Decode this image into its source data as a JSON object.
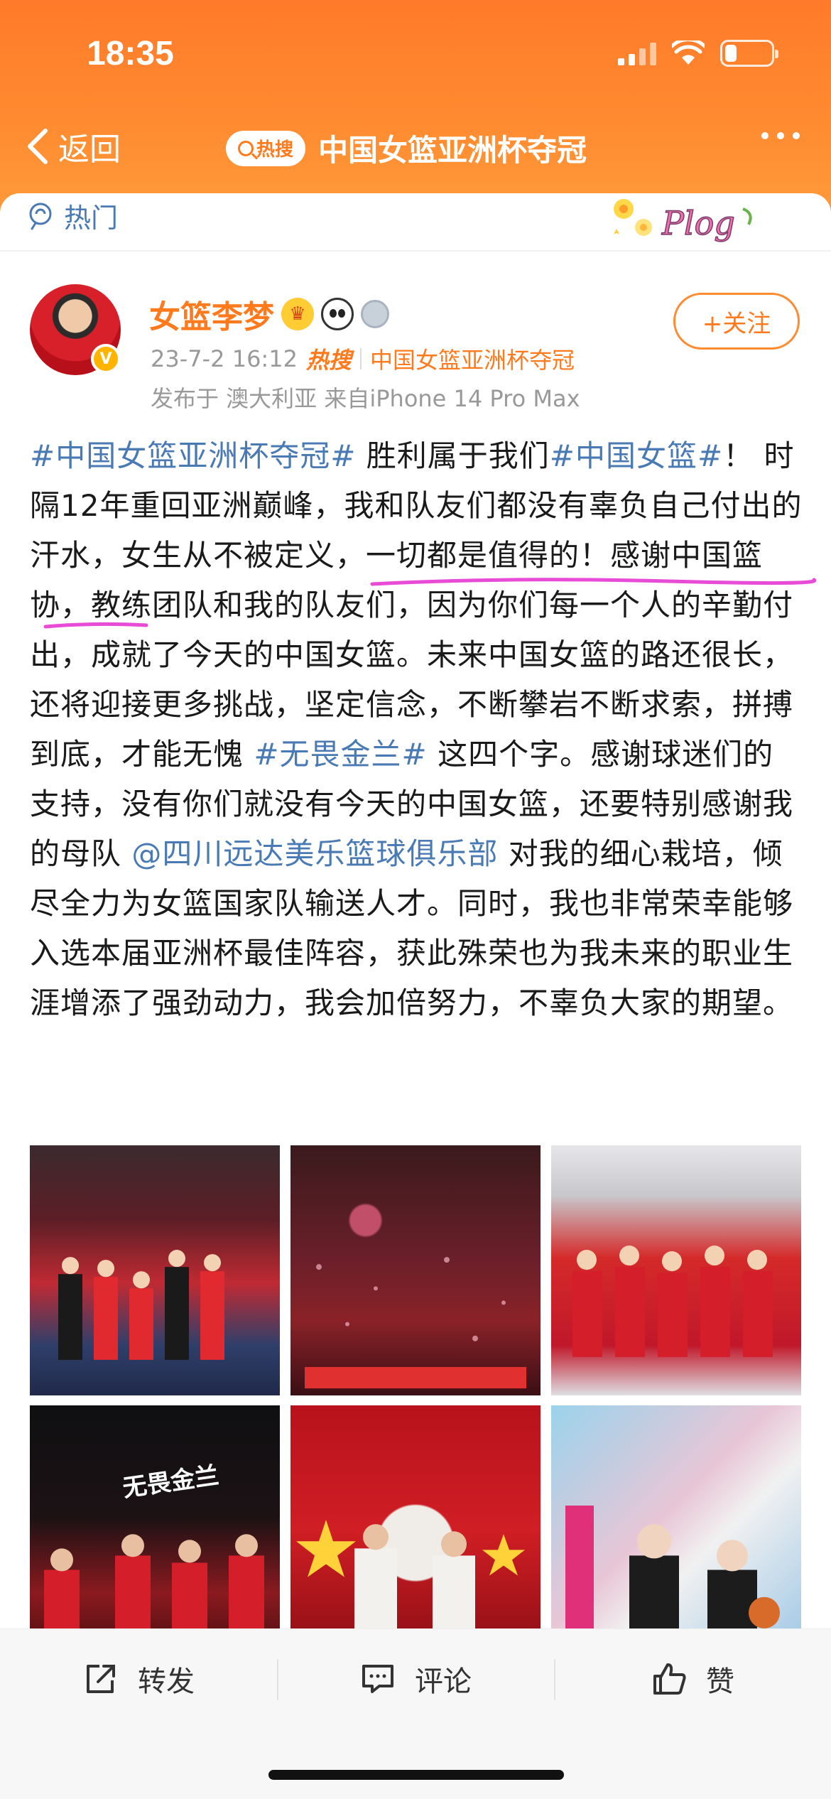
{
  "status_bar": {
    "time": "18:35",
    "battery_level": 0.25
  },
  "nav": {
    "back_label": "返回",
    "hot_pill_label": "热搜",
    "title": "中国女篮亚洲杯夺冠"
  },
  "section": {
    "hot_label": "热门",
    "sticker_text": "Plog"
  },
  "post": {
    "author": "女篮李梦",
    "verified_mark": "V",
    "date": "23-7-2 16:12",
    "hot_logo": "热搜",
    "topic": "中国女篮亚洲杯夺冠",
    "location_device": "发布于 澳大利亚  来自iPhone 14 Pro Max",
    "follow_label": "+关注",
    "text_segments": [
      {
        "text": "#中国女篮亚洲杯夺冠#",
        "link": true
      },
      {
        "text": " 胜利属于我们",
        "link": false
      },
      {
        "text": "#中国女篮#",
        "link": true
      },
      {
        "text": "！ 时隔12年重回亚洲巅峰，我和队友们都没有辜负自己付出的汗水，女生从不被定义，一切都是值得的！感谢中国篮协，教练团队和我的队友们，因为你们每一个人的辛勤付出，成就了今天的中国女篮。未来中国女篮的路还很长，还将迎接更多挑战，坚定信念，不断攀岩不断求索，拼搏到底，才能无愧 ",
        "link": false
      },
      {
        "text": "#无畏金兰#",
        "link": true
      },
      {
        "text": " 这四个字。感谢球迷们的支持，没有你们就没有今天的中国女篮，还要特别感谢我的母队 ",
        "link": false
      },
      {
        "text": "@四川远达美乐篮球俱乐部",
        "link": true
      },
      {
        "text": " 对我的细心栽培，倾尽全力为女篮国家队输送人才。同时，我也非常荣幸能够入选本届亚洲杯最佳阵容，获此殊荣也为我未来的职业生涯增添了强劲动力，我会加倍努力，不辜负大家的期望。",
        "link": false
      }
    ],
    "photos": [
      {
        "name": "photo-award-ceremony"
      },
      {
        "name": "photo-confetti-celebration"
      },
      {
        "name": "photo-team-group"
      },
      {
        "name": "photo-wuwei-jinlan",
        "overlay_text": "无畏金兰"
      },
      {
        "name": "photo-poster-stars"
      },
      {
        "name": "photo-illustration"
      }
    ]
  },
  "actions": {
    "repost": "转发",
    "comment": "评论",
    "like": "赞"
  },
  "colors": {
    "brand_orange": "#ff7a1c",
    "link_blue": "#4a7ab4",
    "highlight_pink": "#e84bd6"
  }
}
